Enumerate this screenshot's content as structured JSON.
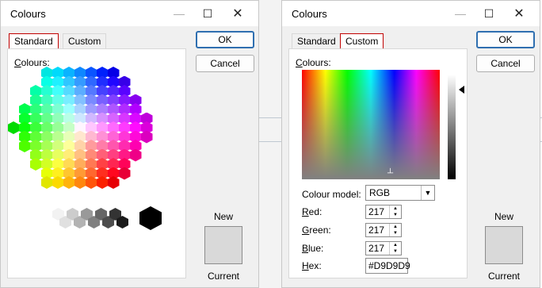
{
  "left_dialog": {
    "title": "Colours",
    "tabs": [
      {
        "label": "Standard"
      },
      {
        "label": "Custom"
      }
    ],
    "active_tab": "Standard",
    "panel_label": "Colours:",
    "buttons": {
      "ok": "OK",
      "cancel": "Cancel"
    },
    "new_label": "New",
    "current_label": "Current",
    "preview_color": "#D9D9D9"
  },
  "right_dialog": {
    "title": "Colours",
    "tabs": [
      {
        "label": "Standard"
      },
      {
        "label": "Custom"
      }
    ],
    "active_tab": "Custom",
    "panel_label": "Colours:",
    "colour_model": {
      "label": "Colour model:",
      "value": "RGB"
    },
    "red": {
      "label": "Red:",
      "value": "217"
    },
    "green": {
      "label": "Green:",
      "value": "217"
    },
    "blue": {
      "label": "Blue:",
      "value": "217"
    },
    "hex": {
      "label": "Hex:",
      "value": "#D9D9D9"
    },
    "buttons": {
      "ok": "OK",
      "cancel": "Cancel"
    },
    "new_label": "New",
    "current_label": "Current"
  },
  "icons": [
    "minimize-icon",
    "maximize-icon",
    "close-icon",
    "chevron-down-icon",
    "spin-up-icon",
    "spin-down-icon",
    "luminance-arrow-icon"
  ]
}
